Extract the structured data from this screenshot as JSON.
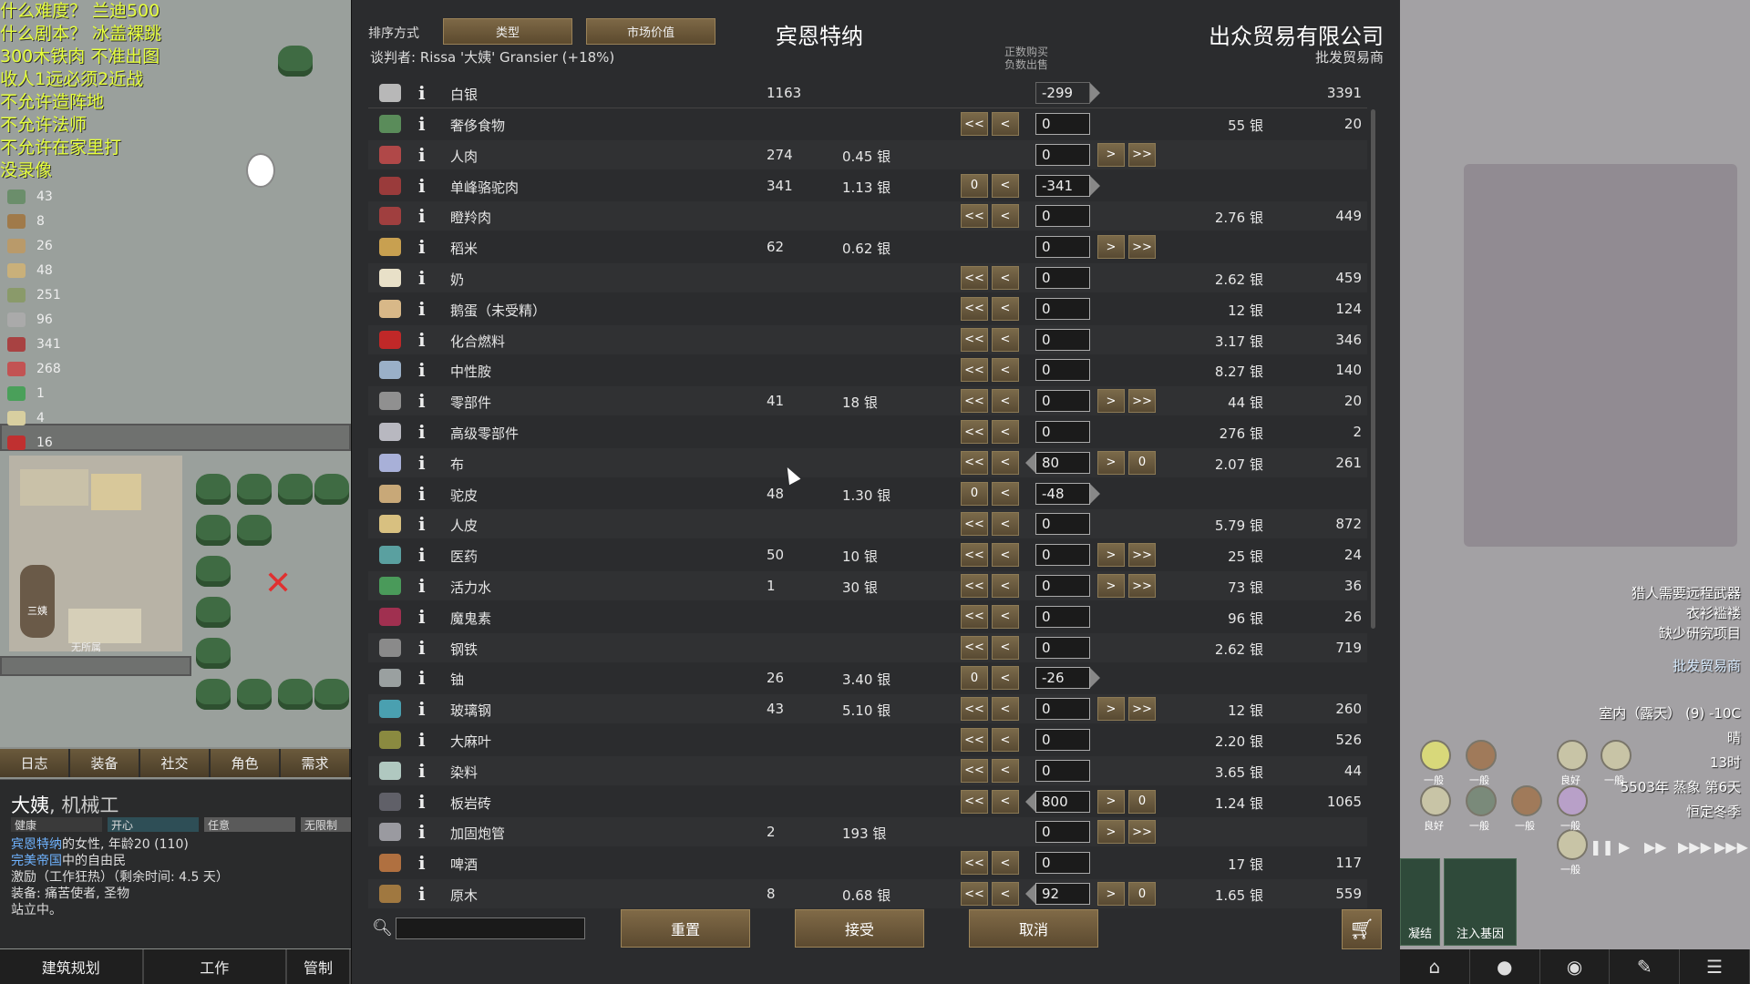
{
  "left": {
    "notes": [
      "什么难度？ 兰迪500",
      "什么剧本？ 冰盖裸跳",
      "300木铁肉 不准出图",
      "收人1远必须2近战",
      "不允许造阵地",
      "不允许法师",
      "不允许在家里打",
      "没录像"
    ],
    "resources": [
      {
        "icon": "pack-icon",
        "count": "43",
        "color": "#6b8e6b"
      },
      {
        "icon": "wood-icon",
        "count": "8",
        "color": "#a07a4a"
      },
      {
        "icon": "leather-icon",
        "count": "26",
        "color": "#b99a6a"
      },
      {
        "icon": "hide-icon",
        "count": "48",
        "color": "#c9b07a"
      },
      {
        "icon": "bundle-icon",
        "count": "251",
        "color": "#8a9a6a"
      },
      {
        "icon": "bone-icon",
        "count": "96",
        "color": "#aaa"
      },
      {
        "icon": "meat-icon",
        "count": "341",
        "color": "#a84242"
      },
      {
        "icon": "raw-meat-icon",
        "count": "268",
        "color": "#c25353"
      },
      {
        "icon": "vial-icon",
        "count": "1",
        "color": "#4aa05a"
      },
      {
        "icon": "medicine-icon",
        "count": "4",
        "color": "#d8cfa0"
      },
      {
        "icon": "chemfuel-icon",
        "count": "16",
        "color": "#c03030"
      }
    ],
    "bed_owner": "无所属",
    "pawn_tag": "三姨",
    "tabs": [
      "日志",
      "装备",
      "社交",
      "角色",
      "需求"
    ],
    "pawn": {
      "name": "大姨",
      "title": "机械工",
      "needs": [
        "健康",
        "开心",
        "任意",
        "无限制"
      ],
      "faction_link": "宾恩特纳",
      "desc_1": "的女性, 年龄20 (110)",
      "empire_link": "完美帝国",
      "desc_2": "中的自由民",
      "line_3": "激励（工作狂热）（剩余时间: 4.5 天）",
      "line_4": "装备: 痛苦使者, 圣物",
      "line_5": "站立中。"
    },
    "arch_tabs": [
      "建筑规划",
      "工作",
      "管制"
    ]
  },
  "dialog": {
    "sort_label": "排序方式",
    "sort_buttons": [
      "类型",
      "市场价值"
    ],
    "colony_name": "宾恩特纳",
    "negotiator": "谈判者: Rissa '大姨' Gransier (+18%)",
    "trader_name": "出众贸易有限公司",
    "trader_kind": "批发贸易商",
    "hint_line1": "正数购买",
    "hint_line2": "负数出售",
    "silver": {
      "name": "白银",
      "colony_count": "1163",
      "amount": "-299",
      "trader_count": "3391"
    },
    "rows": [
      {
        "icon_color": "#5a8c5a",
        "name": "奢侈食物",
        "cc": "",
        "cp": "",
        "amt": "0",
        "tp": "55 银",
        "tc": "20",
        "left": "<<",
        "right": ""
      },
      {
        "icon_color": "#b04848",
        "name": "人肉",
        "cc": "274",
        "cp": "0.45 银",
        "amt": "0",
        "tp": "",
        "tc": "",
        "left": "",
        "right": ">>"
      },
      {
        "icon_color": "#9a3b3b",
        "name": "单峰骆驼肉",
        "cc": "341",
        "cp": "1.13 银",
        "amt": "-341",
        "tp": "",
        "tc": "",
        "left": "0",
        "right": ""
      },
      {
        "icon_color": "#a03f3f",
        "name": "瞪羚肉",
        "cc": "",
        "cp": "",
        "amt": "0",
        "tp": "2.76 银",
        "tc": "449",
        "left": "<<",
        "right": ""
      },
      {
        "icon_color": "#c8a050",
        "name": "稻米",
        "cc": "62",
        "cp": "0.62 银",
        "amt": "0",
        "tp": "",
        "tc": "",
        "left": "",
        "right": ">>"
      },
      {
        "icon_color": "#e8e0c8",
        "name": "奶",
        "cc": "",
        "cp": "",
        "amt": "0",
        "tp": "2.62 银",
        "tc": "459",
        "left": "<<",
        "right": ""
      },
      {
        "icon_color": "#d8b888",
        "name": "鹅蛋（未受精）",
        "cc": "",
        "cp": "",
        "amt": "0",
        "tp": "12 银",
        "tc": "124",
        "left": "<<",
        "right": ""
      },
      {
        "icon_color": "#c02828",
        "name": "化合燃料",
        "cc": "",
        "cp": "",
        "amt": "0",
        "tp": "3.17 银",
        "tc": "346",
        "left": "<<",
        "right": ""
      },
      {
        "icon_color": "#9ab0c8",
        "name": "中性胺",
        "cc": "",
        "cp": "",
        "amt": "0",
        "tp": "8.27 银",
        "tc": "140",
        "left": "<<",
        "right": ""
      },
      {
        "icon_color": "#909090",
        "name": "零部件",
        "cc": "41",
        "cp": "18 银",
        "amt": "0",
        "tp": "44 银",
        "tc": "20",
        "left": "<<",
        "right": ">>"
      },
      {
        "icon_color": "#b8b8c0",
        "name": "高级零部件",
        "cc": "",
        "cp": "",
        "amt": "0",
        "tp": "276 银",
        "tc": "2",
        "left": "<<",
        "right": ""
      },
      {
        "icon_color": "#a8b0d8",
        "name": "布",
        "cc": "",
        "cp": "",
        "amt": "80",
        "tp": "2.07 银",
        "tc": "261",
        "left": "<<",
        "right": "0"
      },
      {
        "icon_color": "#c8a878",
        "name": "驼皮",
        "cc": "48",
        "cp": "1.30 银",
        "amt": "-48",
        "tp": "",
        "tc": "",
        "left": "0",
        "right": ""
      },
      {
        "icon_color": "#d8c080",
        "name": "人皮",
        "cc": "",
        "cp": "",
        "amt": "0",
        "tp": "5.79 银",
        "tc": "872",
        "left": "<<",
        "right": ""
      },
      {
        "icon_color": "#5aa0a0",
        "name": "医药",
        "cc": "50",
        "cp": "10 银",
        "amt": "0",
        "tp": "25 银",
        "tc": "24",
        "left": "<<",
        "right": ">>"
      },
      {
        "icon_color": "#4a9a5a",
        "name": "活力水",
        "cc": "1",
        "cp": "30 银",
        "amt": "0",
        "tp": "73 银",
        "tc": "36",
        "left": "<<",
        "right": ">>"
      },
      {
        "icon_color": "#a03050",
        "name": "魔鬼素",
        "cc": "",
        "cp": "",
        "amt": "0",
        "tp": "96 银",
        "tc": "26",
        "left": "<<",
        "right": ""
      },
      {
        "icon_color": "#8a8a8a",
        "name": "钢铁",
        "cc": "",
        "cp": "",
        "amt": "0",
        "tp": "2.62 银",
        "tc": "719",
        "left": "<<",
        "right": ""
      },
      {
        "icon_color": "#9aa0a0",
        "name": "铀",
        "cc": "26",
        "cp": "3.40 银",
        "amt": "-26",
        "tp": "",
        "tc": "",
        "left": "0",
        "right": ""
      },
      {
        "icon_color": "#4aa0b0",
        "name": "玻璃钢",
        "cc": "43",
        "cp": "5.10 银",
        "amt": "0",
        "tp": "12 银",
        "tc": "260",
        "left": "<<",
        "right": ">>"
      },
      {
        "icon_color": "#8a8a40",
        "name": "大麻叶",
        "cc": "",
        "cp": "",
        "amt": "0",
        "tp": "2.20 银",
        "tc": "526",
        "left": "<<",
        "right": ""
      },
      {
        "icon_color": "#b0c8c0",
        "name": "染料",
        "cc": "",
        "cp": "",
        "amt": "0",
        "tp": "3.65 银",
        "tc": "44",
        "left": "<<",
        "right": ""
      },
      {
        "icon_color": "#606068",
        "name": "板岩砖",
        "cc": "",
        "cp": "",
        "amt": "800",
        "tp": "1.24 银",
        "tc": "1065",
        "left": "<<",
        "right": "0"
      },
      {
        "icon_color": "#9a9aa0",
        "name": "加固炮管",
        "cc": "2",
        "cp": "193 银",
        "amt": "0",
        "tp": "",
        "tc": "",
        "left": "",
        "right": ">>"
      },
      {
        "icon_color": "#b07040",
        "name": "啤酒",
        "cc": "",
        "cp": "",
        "amt": "0",
        "tp": "17 银",
        "tc": "117",
        "left": "<<",
        "right": ""
      },
      {
        "icon_color": "#a07840",
        "name": "原木",
        "cc": "8",
        "cp": "0.68 银",
        "amt": "92",
        "tp": "1.65 银",
        "tc": "559",
        "left": "<<",
        "right": "0"
      }
    ],
    "buttons": {
      "reset": "重置",
      "accept": "接受",
      "cancel": "取消"
    }
  },
  "right": {
    "alerts": [
      "猎人需要远程武器",
      "衣衫褴褛",
      "缺少研究项目",
      "批发贸易商"
    ],
    "temperature": "室内（露天） (9) -10C",
    "weather": "晴",
    "time": "13时",
    "date": "5503年 蒸象 第6天",
    "season": "恒定冬季",
    "gear_labels": [
      "一般",
      "一般",
      "良好",
      "一般",
      "良好",
      "一般",
      "一般",
      "一般",
      "一般"
    ],
    "gene_buttons": [
      "凝结",
      "注入基因"
    ]
  }
}
